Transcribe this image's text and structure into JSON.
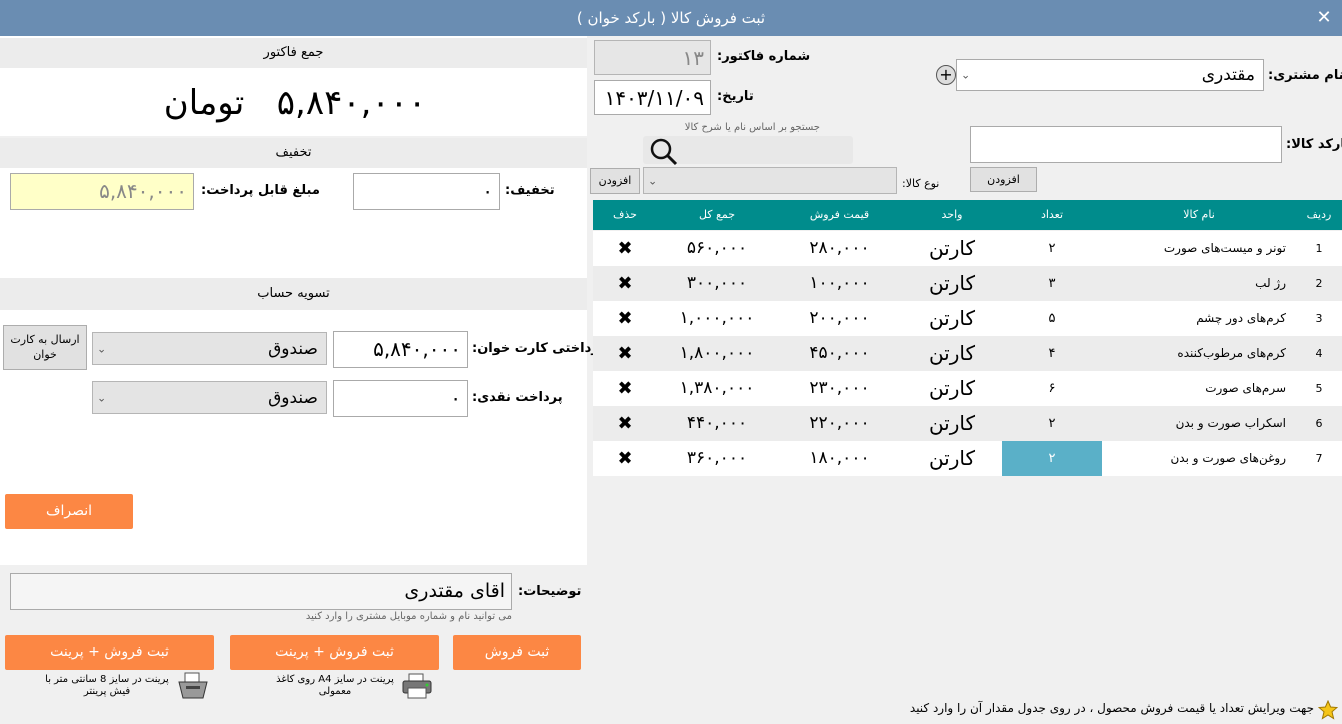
{
  "window": {
    "title": "ثبت فروش کالا ( بارکد خوان )",
    "close_glyph": "✕"
  },
  "invoice_total": {
    "header": "جمع فاکتور",
    "amount": "۵,۸۴۰,۰۰۰",
    "currency": "تومان"
  },
  "discount_section": {
    "header": "تخفیف",
    "discount_label": "تخفیف:",
    "discount_value": "۰",
    "payable_label": "مبلغ قابل پرداخت:",
    "payable_value": "۵,۸۴۰,۰۰۰"
  },
  "settlement": {
    "header": "تسویه حساب",
    "card_label": "پرداختی کارت خوان:",
    "card_value": "۵,۸۴۰,۰۰۰",
    "card_account": "صندوق",
    "send_button": "ارسال به کارت خوان",
    "cash_label": "پرداخت نقدی:",
    "cash_value": "۰",
    "cash_account": "صندوق",
    "cancel_button": "انصراف"
  },
  "notes": {
    "label": "توضیحات:",
    "value": "اقای مقتدری",
    "hint": "می توانید نام و شماره موبایل مشتری را وارد کنید"
  },
  "actions": {
    "submit": "ثبت فروش",
    "submit_print_a4": "ثبت فروش + پرینت",
    "a4_note": "پرینت در سایز A4 روی کاغذ معمولی",
    "submit_print_receipt": "ثبت فروش + پرینت",
    "receipt_note": "پرینت در سایز 8 سانتی متر با فیش پرینتر"
  },
  "header_form": {
    "invoice_no_label": "شماره فاکتور:",
    "invoice_no": "۱۳",
    "date_label": "تاریخ:",
    "date": "۱۴۰۳/۱۱/۰۹",
    "customer_label": "نام مشتری:",
    "customer": "مقتدری"
  },
  "barcode": {
    "label": "بارکد کالا:",
    "add_button": "افزودن",
    "search_hint": "جستجو بر اساس نام یا شرح کالا",
    "type_label": "نوع کالا:",
    "add_button2": "افزودن"
  },
  "table": {
    "headers": {
      "idx": "ردیف",
      "name": "نام کالا",
      "qty": "تعداد",
      "unit": "واحد",
      "price": "قیمت فروش",
      "total": "جمع کل",
      "del": "حذف"
    },
    "rows": [
      {
        "idx": "1",
        "name": "تونر و میست‌های صورت",
        "qty": "۲",
        "unit": "کارتن",
        "price": "۲۸۰,۰۰۰",
        "total": "۵۶۰,۰۰۰"
      },
      {
        "idx": "2",
        "name": "رژ لب",
        "qty": "۳",
        "unit": "کارتن",
        "price": "۱۰۰,۰۰۰",
        "total": "۳۰۰,۰۰۰"
      },
      {
        "idx": "3",
        "name": "کرم‌های دور چشم",
        "qty": "۵",
        "unit": "کارتن",
        "price": "۲۰۰,۰۰۰",
        "total": "۱,۰۰۰,۰۰۰"
      },
      {
        "idx": "4",
        "name": "کرم‌های مرطوب‌کننده",
        "qty": "۴",
        "unit": "کارتن",
        "price": "۴۵۰,۰۰۰",
        "total": "۱,۸۰۰,۰۰۰"
      },
      {
        "idx": "5",
        "name": "سرم‌های صورت",
        "qty": "۶",
        "unit": "کارتن",
        "price": "۲۳۰,۰۰۰",
        "total": "۱,۳۸۰,۰۰۰"
      },
      {
        "idx": "6",
        "name": "اسکراب صورت و بدن",
        "qty": "۲",
        "unit": "کارتن",
        "price": "۲۲۰,۰۰۰",
        "total": "۴۴۰,۰۰۰"
      },
      {
        "idx": "7",
        "name": "روغن‌های صورت و بدن",
        "qty": "۲",
        "unit": "کارتن",
        "price": "۱۸۰,۰۰۰",
        "total": "۳۶۰,۰۰۰"
      }
    ],
    "delete_glyph": "✖"
  },
  "footer": {
    "tip": "جهت ویرایش تعداد یا قیمت فروش محصول ، در روی جدول مقدار آن را وارد کنید"
  },
  "colors": {
    "titlebar": "#6a8db2",
    "table_header": "#008c8c",
    "accent": "#fc8744",
    "selected_cell": "#5ab0c8",
    "payable_bg": "#ffffc8"
  }
}
